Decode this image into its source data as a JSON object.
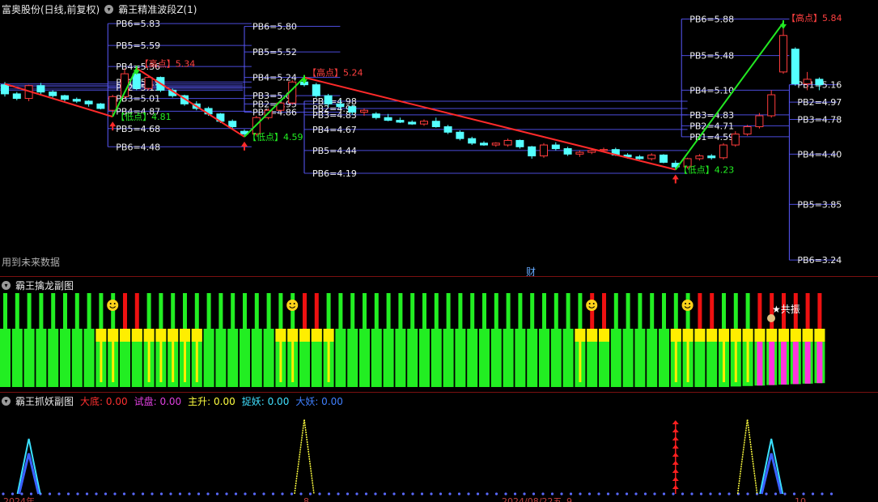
{
  "main": {
    "title": "富奥股份(日线,前复权)",
    "indicator": "霸王精准波段Z(1)",
    "future_note": "用到未来数据",
    "cai_label": "财"
  },
  "sub1": {
    "title": "霸王擒龙副图",
    "star_label": "★共振"
  },
  "sub2": {
    "title": "霸王抓妖副图",
    "metrics": [
      {
        "label": "大底:",
        "value": "0.00",
        "color": "#ff3030"
      },
      {
        "label": "试盘:",
        "value": "0.00",
        "color": "#e040e0"
      },
      {
        "label": "主升:",
        "value": "0.00",
        "color": "#ffff40"
      },
      {
        "label": "捉妖:",
        "value": "0.00",
        "color": "#40e0ff"
      },
      {
        "label": "大妖:",
        "value": "0.00",
        "color": "#4080ff"
      }
    ],
    "bottom_ticks": [
      "2024年",
      "8",
      "2024/08/22五",
      "9",
      "10"
    ]
  },
  "colors": {
    "up": "#ff3c3c",
    "down": "#54ffff",
    "bg": "#000000",
    "pb_level": "#ffffff",
    "pb_line": "#5a5aff",
    "zigzag_down": "#ff2a2a",
    "zigzag_up": "#22e822",
    "green_bar": "#22ee22",
    "yellow_bar": "#ffee00",
    "red_bar": "#ee1111",
    "magenta_bar": "#ff33dd"
  },
  "chart_data": {
    "type": "candlestick",
    "title": "富奥股份(日线,前复权)",
    "ylim": [
      4.0,
      5.9
    ],
    "candles": [
      {
        "o": 5.16,
        "h": 5.19,
        "l": 5.03,
        "c": 5.06
      },
      {
        "o": 5.06,
        "h": 5.08,
        "l": 4.99,
        "c": 5.01
      },
      {
        "o": 5.01,
        "h": 5.16,
        "l": 4.98,
        "c": 5.15
      },
      {
        "o": 5.15,
        "h": 5.18,
        "l": 5.05,
        "c": 5.08
      },
      {
        "o": 5.08,
        "h": 5.1,
        "l": 5.02,
        "c": 5.04
      },
      {
        "o": 5.04,
        "h": 5.05,
        "l": 4.98,
        "c": 5.0
      },
      {
        "o": 5.0,
        "h": 5.02,
        "l": 4.96,
        "c": 4.98
      },
      {
        "o": 4.98,
        "h": 4.99,
        "l": 4.92,
        "c": 4.95
      },
      {
        "o": 4.95,
        "h": 4.96,
        "l": 4.89,
        "c": 4.9
      },
      {
        "o": 4.88,
        "h": 5.05,
        "l": 4.81,
        "c": 5.03
      },
      {
        "o": 5.03,
        "h": 5.34,
        "l": 5.01,
        "c": 5.28
      },
      {
        "o": 5.28,
        "h": 5.31,
        "l": 5.1,
        "c": 5.12
      },
      {
        "o": 5.12,
        "h": 5.26,
        "l": 5.1,
        "c": 5.24
      },
      {
        "o": 5.24,
        "h": 5.25,
        "l": 5.08,
        "c": 5.1
      },
      {
        "o": 5.1,
        "h": 5.12,
        "l": 5.02,
        "c": 5.04
      },
      {
        "o": 5.04,
        "h": 5.05,
        "l": 4.93,
        "c": 4.95
      },
      {
        "o": 4.95,
        "h": 4.98,
        "l": 4.88,
        "c": 4.9
      },
      {
        "o": 4.9,
        "h": 4.92,
        "l": 4.82,
        "c": 4.84
      },
      {
        "o": 4.84,
        "h": 4.85,
        "l": 4.74,
        "c": 4.76
      },
      {
        "o": 4.76,
        "h": 4.78,
        "l": 4.68,
        "c": 4.7
      },
      {
        "o": 4.65,
        "h": 4.67,
        "l": 4.59,
        "c": 4.62
      },
      {
        "o": 4.62,
        "h": 4.82,
        "l": 4.6,
        "c": 4.8
      },
      {
        "o": 4.8,
        "h": 4.9,
        "l": 4.78,
        "c": 4.88
      },
      {
        "o": 4.88,
        "h": 4.98,
        "l": 4.86,
        "c": 4.96
      },
      {
        "o": 4.96,
        "h": 5.21,
        "l": 4.94,
        "c": 5.19
      },
      {
        "o": 5.19,
        "h": 5.24,
        "l": 5.14,
        "c": 5.16
      },
      {
        "o": 5.16,
        "h": 5.18,
        "l": 5.02,
        "c": 5.04
      },
      {
        "o": 5.04,
        "h": 5.06,
        "l": 4.92,
        "c": 4.95
      },
      {
        "o": 4.95,
        "h": 5.0,
        "l": 4.89,
        "c": 4.92
      },
      {
        "o": 4.92,
        "h": 4.94,
        "l": 4.83,
        "c": 4.86
      },
      {
        "o": 4.86,
        "h": 4.9,
        "l": 4.82,
        "c": 4.88
      },
      {
        "o": 4.84,
        "h": 4.86,
        "l": 4.78,
        "c": 4.8
      },
      {
        "o": 4.8,
        "h": 4.84,
        "l": 4.76,
        "c": 4.77
      },
      {
        "o": 4.77,
        "h": 4.8,
        "l": 4.74,
        "c": 4.75
      },
      {
        "o": 4.75,
        "h": 4.77,
        "l": 4.72,
        "c": 4.73
      },
      {
        "o": 4.73,
        "h": 4.78,
        "l": 4.71,
        "c": 4.76
      },
      {
        "o": 4.76,
        "h": 4.8,
        "l": 4.69,
        "c": 4.7
      },
      {
        "o": 4.7,
        "h": 4.72,
        "l": 4.62,
        "c": 4.64
      },
      {
        "o": 4.64,
        "h": 4.66,
        "l": 4.55,
        "c": 4.57
      },
      {
        "o": 4.57,
        "h": 4.59,
        "l": 4.5,
        "c": 4.52
      },
      {
        "o": 4.52,
        "h": 4.54,
        "l": 4.49,
        "c": 4.5
      },
      {
        "o": 4.5,
        "h": 4.53,
        "l": 4.48,
        "c": 4.52
      },
      {
        "o": 4.5,
        "h": 4.57,
        "l": 4.48,
        "c": 4.55
      },
      {
        "o": 4.55,
        "h": 4.56,
        "l": 4.46,
        "c": 4.48
      },
      {
        "o": 4.48,
        "h": 4.49,
        "l": 4.35,
        "c": 4.38
      },
      {
        "o": 4.38,
        "h": 4.52,
        "l": 4.36,
        "c": 4.5
      },
      {
        "o": 4.5,
        "h": 4.53,
        "l": 4.44,
        "c": 4.46
      },
      {
        "o": 4.46,
        "h": 4.48,
        "l": 4.38,
        "c": 4.4
      },
      {
        "o": 4.4,
        "h": 4.44,
        "l": 4.37,
        "c": 4.42
      },
      {
        "o": 4.42,
        "h": 4.46,
        "l": 4.4,
        "c": 4.44
      },
      {
        "o": 4.44,
        "h": 4.47,
        "l": 4.42,
        "c": 4.45
      },
      {
        "o": 4.45,
        "h": 4.47,
        "l": 4.38,
        "c": 4.39
      },
      {
        "o": 4.39,
        "h": 4.41,
        "l": 4.35,
        "c": 4.37
      },
      {
        "o": 4.37,
        "h": 4.39,
        "l": 4.34,
        "c": 4.35
      },
      {
        "o": 4.35,
        "h": 4.41,
        "l": 4.33,
        "c": 4.39
      },
      {
        "o": 4.39,
        "h": 4.4,
        "l": 4.3,
        "c": 4.31
      },
      {
        "o": 4.3,
        "h": 4.33,
        "l": 4.23,
        "c": 4.26
      },
      {
        "o": 4.26,
        "h": 4.36,
        "l": 4.24,
        "c": 4.35
      },
      {
        "o": 4.35,
        "h": 4.4,
        "l": 4.33,
        "c": 4.38
      },
      {
        "o": 4.38,
        "h": 4.4,
        "l": 4.34,
        "c": 4.36
      },
      {
        "o": 4.36,
        "h": 4.52,
        "l": 4.34,
        "c": 4.5
      },
      {
        "o": 4.5,
        "h": 4.65,
        "l": 4.48,
        "c": 4.62
      },
      {
        "o": 4.62,
        "h": 4.72,
        "l": 4.6,
        "c": 4.7
      },
      {
        "o": 4.7,
        "h": 4.85,
        "l": 4.68,
        "c": 4.82
      },
      {
        "o": 4.82,
        "h": 5.1,
        "l": 4.8,
        "c": 5.05
      },
      {
        "o": 5.3,
        "h": 5.84,
        "l": 5.28,
        "c": 5.7
      },
      {
        "o": 5.55,
        "h": 5.57,
        "l": 5.15,
        "c": 5.17
      },
      {
        "o": 5.17,
        "h": 5.3,
        "l": 5.1,
        "c": 5.22
      },
      {
        "o": 5.22,
        "h": 5.24,
        "l": 5.1,
        "c": 5.16
      }
    ],
    "zigzag": [
      {
        "i": 0,
        "v": 5.17,
        "kind": "start"
      },
      {
        "i": 9,
        "v": 4.81,
        "kind": "low",
        "label": "【低点】4.81"
      },
      {
        "i": 11,
        "v": 5.34,
        "kind": "high",
        "label": "【高点】5.34"
      },
      {
        "i": 20,
        "v": 4.59,
        "kind": "low",
        "label": "【低点】4.59"
      },
      {
        "i": 25,
        "v": 5.24,
        "kind": "high",
        "label": "【高点】5.24"
      },
      {
        "i": 56,
        "v": 4.23,
        "kind": "low",
        "label": "【低点】4.23"
      },
      {
        "i": 65,
        "v": 5.84,
        "kind": "high",
        "label": "【高点】5.84"
      }
    ],
    "pb_sets": [
      {
        "x_i": 8.6,
        "span": 12,
        "levels": [
          {
            "n": "PB6",
            "v": 4.48
          },
          {
            "n": "PB5",
            "v": 4.68
          },
          {
            "n": "PB4",
            "v": 4.87
          },
          {
            "n": "PB3",
            "v": 5.01
          },
          {
            "n": "PB2",
            "v": 5.13
          },
          {
            "n": "PB1",
            "v": 5.19
          },
          {
            "n": "PB4",
            "v": 5.36
          },
          {
            "n": "PB5",
            "v": 5.59
          },
          {
            "n": "PB6",
            "v": 5.83
          }
        ]
      },
      {
        "x_i": 20,
        "span": 8,
        "levels": [
          {
            "n": "PB6",
            "v": 5.8
          },
          {
            "n": "PB5",
            "v": 5.52
          },
          {
            "n": "PB4",
            "v": 5.24
          },
          {
            "n": "PB3",
            "v": 5.04
          },
          {
            "n": "PB2",
            "v": 4.95
          },
          {
            "n": "PB1",
            "v": 4.86
          }
        ]
      },
      {
        "x_i": 25,
        "span": 32,
        "levels": [
          {
            "n": "PB1",
            "v": 4.98
          },
          {
            "n": "PB2",
            "v": 4.9
          },
          {
            "n": "PB3",
            "v": 4.83
          },
          {
            "n": "PB4",
            "v": 4.67
          },
          {
            "n": "PB5",
            "v": 4.44
          },
          {
            "n": "PB6",
            "v": 4.19
          }
        ]
      },
      {
        "x_i": 56.5,
        "span": 9,
        "levels": [
          {
            "n": "PB6",
            "v": 5.88
          },
          {
            "n": "PB5",
            "v": 5.48
          },
          {
            "n": "PB4",
            "v": 5.1
          },
          {
            "n": "PB3",
            "v": 4.83
          },
          {
            "n": "PB2",
            "v": 4.71
          },
          {
            "n": "PB1",
            "v": 4.59
          }
        ]
      },
      {
        "x_i": 65.5,
        "span": 4,
        "levels": [
          {
            "n": "PB1",
            "v": 5.16
          },
          {
            "n": "PB2",
            "v": 4.97
          },
          {
            "n": "PB3",
            "v": 4.78
          },
          {
            "n": "PB4",
            "v": 4.4
          },
          {
            "n": "PB5",
            "v": 3.85
          },
          {
            "n": "PB6",
            "v": 3.24
          }
        ]
      }
    ],
    "sub1_bars": [
      "g",
      "g",
      "g",
      "g",
      "g",
      "g",
      "g",
      "g",
      "y",
      "y",
      "r",
      "r",
      "y",
      "y",
      "y",
      "y",
      "y",
      "g",
      "g",
      "g",
      "g",
      "g",
      "g",
      "y",
      "y",
      "r",
      "r",
      "y",
      "g",
      "g",
      "g",
      "g",
      "g",
      "g",
      "g",
      "g",
      "g",
      "g",
      "g",
      "g",
      "g",
      "g",
      "g",
      "g",
      "g",
      "g",
      "g",
      "g",
      "y",
      "r",
      "r",
      "g",
      "g",
      "g",
      "g",
      "g",
      "y",
      "y",
      "r",
      "r",
      "y",
      "y",
      "y",
      "m",
      "m",
      "m",
      "m",
      "m",
      "m"
    ],
    "smiley_at": [
      9,
      24,
      49,
      57
    ],
    "sub2_peaks": [
      {
        "i": 2,
        "kind": "cyan"
      },
      {
        "i": 25,
        "kind": "yellow"
      },
      {
        "i": 56,
        "kind": "red_arrows"
      },
      {
        "i": 62,
        "kind": "yellow"
      },
      {
        "i": 64,
        "kind": "cyan"
      }
    ]
  }
}
